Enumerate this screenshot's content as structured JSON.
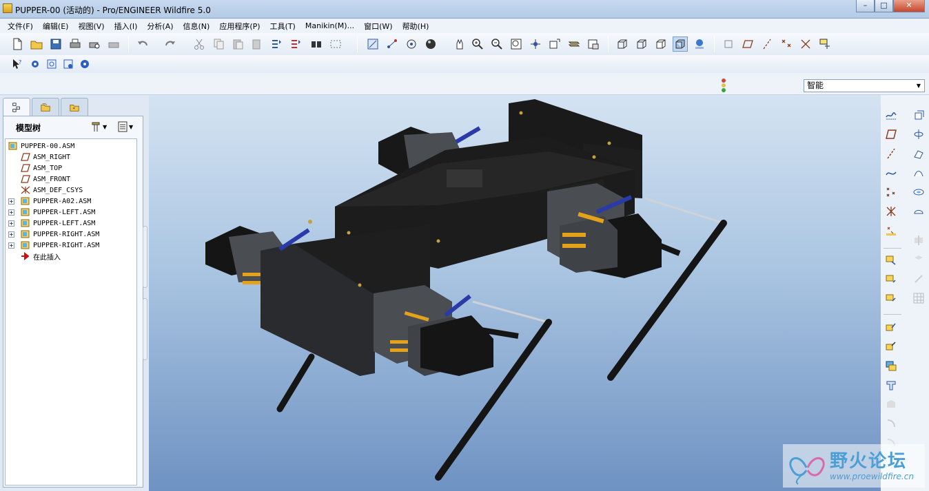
{
  "window": {
    "title": "PUPPER-00 (活动的) - Pro/ENGINEER Wildfire 5.0",
    "minimize": "–",
    "maximize": "□",
    "close": "✕"
  },
  "menu": [
    "文件(F)",
    "编辑(E)",
    "视图(V)",
    "插入(I)",
    "分析(A)",
    "信息(N)",
    "应用程序(P)",
    "工具(T)",
    "Manikin(M)...",
    "窗口(W)",
    "帮助(H)"
  ],
  "filter": {
    "value": "智能"
  },
  "model_tree": {
    "title": "模型树",
    "items": [
      {
        "label": "PUPPER-00.ASM",
        "icon": "assembly-icon"
      },
      {
        "label": "ASM_RIGHT",
        "icon": "datum-plane-icon"
      },
      {
        "label": "ASM_TOP",
        "icon": "datum-plane-icon"
      },
      {
        "label": "ASM_FRONT",
        "icon": "datum-plane-icon"
      },
      {
        "label": "ASM_DEF_CSYS",
        "icon": "csys-icon"
      },
      {
        "label": "PUPPER-A02.ASM",
        "icon": "assembly-icon"
      },
      {
        "label": "PUPPER-LEFT.ASM",
        "icon": "assembly-icon"
      },
      {
        "label": "PUPPER-LEFT.ASM",
        "icon": "assembly-icon"
      },
      {
        "label": "PUPPER-RIGHT.ASM",
        "icon": "assembly-icon"
      },
      {
        "label": "PUPPER-RIGHT.ASM",
        "icon": "assembly-icon"
      },
      {
        "label": "在此插入",
        "icon": "insert-here-arrow-icon"
      }
    ]
  },
  "watermark": {
    "text": "野火论坛",
    "url": "www.proewildfire.cn"
  },
  "colors": {
    "viewport_top": "#d4e3f2",
    "viewport_bottom": "#6e92c2",
    "model_body": "#1c1c1c",
    "bracket_grey": "#4a4d52",
    "linkage_blue": "#2a3aa8",
    "shaft_orange": "#e3a21a"
  }
}
